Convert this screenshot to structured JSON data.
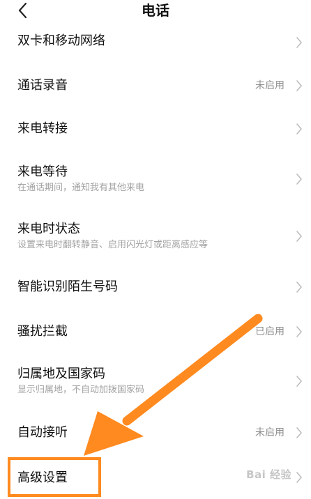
{
  "header": {
    "title": "电话"
  },
  "items": [
    {
      "label": "双卡和移动网络",
      "sub": "",
      "status": ""
    },
    {
      "label": "通话录音",
      "sub": "",
      "status": "未启用"
    },
    {
      "label": "来电转接",
      "sub": "",
      "status": ""
    },
    {
      "label": "来电等待",
      "sub": "在通话期间，通知我有其他来电",
      "status": ""
    },
    {
      "label": "来电时状态",
      "sub": "设置来电时翻转静音、启用闪光灯或距离感应等",
      "status": ""
    },
    {
      "label": "智能识别陌生号码",
      "sub": "",
      "status": ""
    },
    {
      "label": "骚扰拦截",
      "sub": "",
      "status": "已启用"
    },
    {
      "label": "归属地及国家码",
      "sub": "显示归属地，不自动加拨国家码",
      "status": ""
    },
    {
      "label": "自动接听",
      "sub": "",
      "status": "未启用"
    },
    {
      "label": "高级设置",
      "sub": "",
      "status": ""
    }
  ],
  "annotation": {
    "arrow_color": "#ff8a1f"
  },
  "watermark": {
    "text": "Bai 经验"
  },
  "icons": {
    "back": "chevron-left-icon",
    "row": "chevron-right-icon"
  }
}
